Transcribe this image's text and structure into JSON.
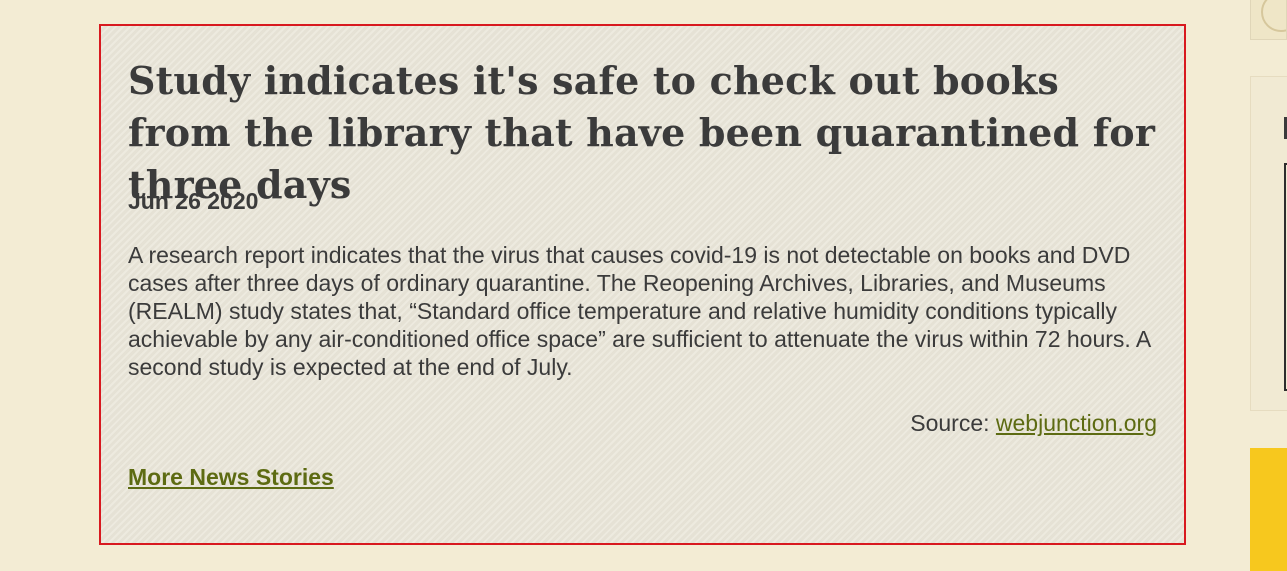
{
  "article": {
    "headline": "Study indicates it's safe to check out books from the library that have been quarantined for three days",
    "date": "Jun 26 2020",
    "body": "A research report indicates that the virus that causes covid-19 is not detectable on books and DVD cases after three days of ordinary quarantine. The Reopening Archives, Libraries, and Museums (REALM) study states that, “Standard office temperature and relative humidity conditions typically achievable by any air-conditioned office space” are sufficient to attenuate the virus within 72 hours. A second study is expected at the end of July.",
    "source_label": "Source:",
    "source_link": "webjunction.org",
    "more_link": "More News Stories"
  },
  "colors": {
    "border_highlight": "#d8191f",
    "link": "#5d6b12",
    "text": "#3b3b3b",
    "page_bg": "#f3ecd4",
    "card_bg": "#e9e5d8",
    "sidebar_accent": "#f7c81e"
  }
}
